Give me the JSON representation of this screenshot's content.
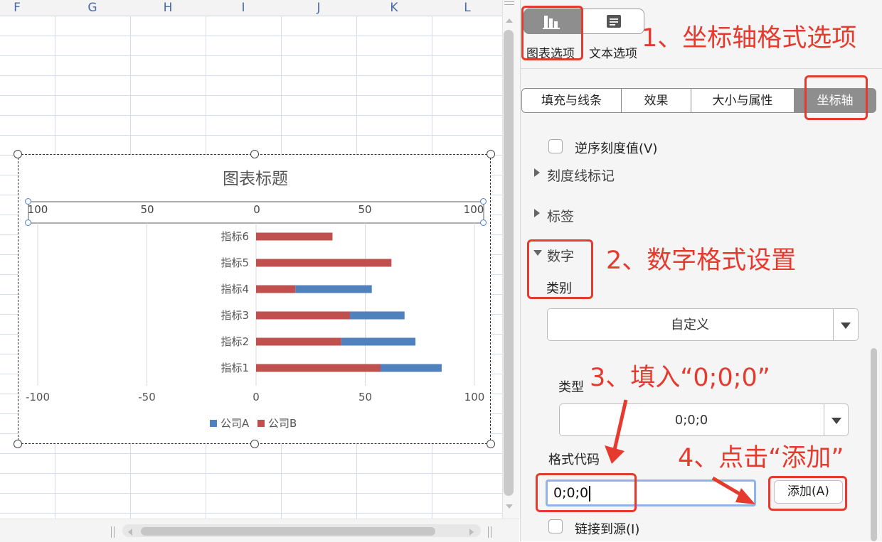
{
  "sheet": {
    "columns": [
      "F",
      "G",
      "H",
      "I",
      "J",
      "K",
      "L"
    ]
  },
  "chart": {
    "title": "图表标题",
    "top_axis_ticks": [
      "100",
      "50",
      "0",
      "50",
      "100"
    ],
    "legend": [
      {
        "name": "公司A",
        "color": "#4f81bd"
      },
      {
        "name": "公司B",
        "color": "#c0504d"
      }
    ]
  },
  "chart_data": {
    "type": "bar",
    "orientation": "horizontal",
    "stacked": true,
    "title": "图表标题",
    "categories": [
      "指标1",
      "指标2",
      "指标3",
      "指标4",
      "指标5",
      "指标6"
    ],
    "series": [
      {
        "name": "公司B",
        "color": "#c0504d",
        "values": [
          57,
          39,
          43,
          18,
          62,
          35
        ]
      },
      {
        "name": "公司A",
        "color": "#4f81bd",
        "values": [
          28,
          34,
          25,
          35,
          0,
          0
        ]
      }
    ],
    "xlim": [
      -100,
      100
    ],
    "x_ticks": [
      "-100",
      "-50",
      "0",
      "50",
      "100"
    ],
    "grid": true,
    "legend_position": "bottom"
  },
  "panel": {
    "tabs": [
      {
        "label": "图表选项",
        "icon": "bar-chart-icon",
        "active": true
      },
      {
        "label": "文本选项",
        "icon": "text-lines-icon",
        "active": false
      }
    ],
    "subtabs": [
      "填充与线条",
      "效果",
      "大小与属性",
      "坐标轴"
    ],
    "reverse_ticks_label": "逆序刻度值(V)",
    "tick_marks_label": "刻度线标记",
    "labels_label": "标签",
    "number_label": "数字",
    "category_label": "类别",
    "category_value": "自定义",
    "type_label": "类型",
    "type_value": "0;0;0",
    "format_code_label": "格式代码",
    "format_code_value": "0;0;0",
    "add_button": "添加(A)",
    "link_source_label": "链接到源(I)"
  },
  "annotations": {
    "step1": "1、坐标轴格式选项",
    "step2": "2、数字格式设置",
    "step3": "3、填入“0;0;0”",
    "step4": "4、点击“添加”",
    "color": "#e63a2e"
  }
}
